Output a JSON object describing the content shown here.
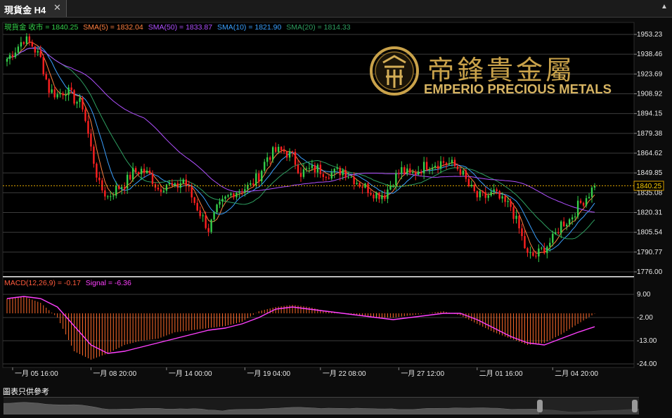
{
  "tab": {
    "title": "現貨金 H4",
    "close": "✕"
  },
  "window": {
    "menu_glyph": "▲"
  },
  "legend": [
    {
      "text": "現貨金 收市 = 1840.25",
      "color": "#35d04a"
    },
    {
      "text": "SMA(5) = 1832.04",
      "color": "#ff8040"
    },
    {
      "text": "SMA(50) = 1833.87",
      "color": "#b050ff"
    },
    {
      "text": "SMA(10) = 1821.90",
      "color": "#3aa0ff"
    },
    {
      "text": "SMA(20) = 1814.33",
      "color": "#2e9e60"
    }
  ],
  "macd_legend": [
    {
      "text": "MACD(12,26,9) = -0.17",
      "color": "#ff5a3c"
    },
    {
      "text": "Signal = -6.36",
      "color": "#ff40ff"
    }
  ],
  "logo": {
    "chinese": "帝鋒貴金屬",
    "english": "EMPERIO PRECIOUS METALS"
  },
  "current_price_label": "1840.25",
  "disclaimer": "圖表只供參考",
  "colors": {
    "up": "#35d04a",
    "down": "#ff2020",
    "gold": "#c9a24a",
    "price_line": "#d9a000"
  },
  "chart_data": {
    "type": "candlestick",
    "price_axis": {
      "ticks": [
        "1953.23",
        "1938.46",
        "1923.69",
        "1908.92",
        "1894.15",
        "1879.38",
        "1864.62",
        "1849.85",
        "1835.08",
        "1820.31",
        "1805.54",
        "1790.77",
        "1776.00"
      ],
      "range": [
        1776.0,
        1953.23
      ]
    },
    "macd_axis": {
      "ticks": [
        "9.00",
        "-2.00",
        "-13.00",
        "-24.00"
      ],
      "range": [
        -24,
        9
      ]
    },
    "time_labels": [
      "一月 05 16:00",
      "一月 08 20:00",
      "一月 14 00:00",
      "一月 19 04:00",
      "一月 22 08:00",
      "一月 27 12:00",
      "二月 01 16:00",
      "二月 04 20:00"
    ],
    "last_close": 1840.25,
    "close_anchors": [
      [
        0,
        1935
      ],
      [
        3,
        1942
      ],
      [
        6,
        1950
      ],
      [
        9,
        1945
      ],
      [
        12,
        1935
      ],
      [
        15,
        1912
      ],
      [
        18,
        1908
      ],
      [
        21,
        1912
      ],
      [
        24,
        1905
      ],
      [
        27,
        1900
      ],
      [
        30,
        1868
      ],
      [
        33,
        1840
      ],
      [
        36,
        1832
      ],
      [
        39,
        1838
      ],
      [
        42,
        1842
      ],
      [
        45,
        1850
      ],
      [
        48,
        1852
      ],
      [
        51,
        1848
      ],
      [
        54,
        1838
      ],
      [
        57,
        1842
      ],
      [
        60,
        1838
      ],
      [
        63,
        1845
      ],
      [
        66,
        1832
      ],
      [
        69,
        1820
      ],
      [
        72,
        1808
      ],
      [
        75,
        1822
      ],
      [
        78,
        1830
      ],
      [
        81,
        1836
      ],
      [
        84,
        1838
      ],
      [
        87,
        1840
      ],
      [
        90,
        1848
      ],
      [
        93,
        1862
      ],
      [
        96,
        1866
      ],
      [
        99,
        1866
      ],
      [
        102,
        1862
      ],
      [
        105,
        1850
      ],
      [
        108,
        1852
      ],
      [
        111,
        1853
      ],
      [
        114,
        1850
      ],
      [
        117,
        1850
      ],
      [
        120,
        1852
      ],
      [
        123,
        1847
      ],
      [
        126,
        1842
      ],
      [
        129,
        1838
      ],
      [
        132,
        1834
      ],
      [
        135,
        1834
      ],
      [
        138,
        1845
      ],
      [
        141,
        1852
      ],
      [
        144,
        1848
      ],
      [
        147,
        1852
      ],
      [
        150,
        1856
      ],
      [
        153,
        1857
      ],
      [
        156,
        1858
      ],
      [
        159,
        1856
      ],
      [
        162,
        1852
      ],
      [
        165,
        1840
      ],
      [
        168,
        1832
      ],
      [
        171,
        1832
      ],
      [
        174,
        1835
      ],
      [
        177,
        1828
      ],
      [
        180,
        1825
      ],
      [
        183,
        1808
      ],
      [
        186,
        1788
      ],
      [
        189,
        1788
      ],
      [
        192,
        1794
      ],
      [
        195,
        1800
      ],
      [
        198,
        1812
      ],
      [
        201,
        1815
      ],
      [
        204,
        1825
      ],
      [
        207,
        1832
      ],
      [
        210,
        1840.25
      ]
    ],
    "macd_anchors": [
      [
        0,
        7
      ],
      [
        6,
        8
      ],
      [
        12,
        5
      ],
      [
        18,
        -2
      ],
      [
        24,
        -18
      ],
      [
        30,
        -22
      ],
      [
        36,
        -19
      ],
      [
        42,
        -15
      ],
      [
        48,
        -13
      ],
      [
        54,
        -12
      ],
      [
        60,
        -9
      ],
      [
        66,
        -8
      ],
      [
        72,
        -7
      ],
      [
        78,
        -6
      ],
      [
        84,
        -4
      ],
      [
        90,
        1
      ],
      [
        96,
        3
      ],
      [
        102,
        4
      ],
      [
        108,
        3
      ],
      [
        114,
        1
      ],
      [
        120,
        0
      ],
      [
        126,
        -1
      ],
      [
        132,
        -2
      ],
      [
        138,
        -2
      ],
      [
        144,
        -1
      ],
      [
        150,
        0
      ],
      [
        156,
        1
      ],
      [
        162,
        -1
      ],
      [
        168,
        -5
      ],
      [
        174,
        -9
      ],
      [
        180,
        -12
      ],
      [
        186,
        -15
      ],
      [
        192,
        -14
      ],
      [
        198,
        -10
      ],
      [
        204,
        -5
      ],
      [
        210,
        -0.17
      ]
    ],
    "signal_anchors": [
      [
        0,
        7
      ],
      [
        6,
        8
      ],
      [
        12,
        7
      ],
      [
        18,
        3
      ],
      [
        24,
        -6
      ],
      [
        30,
        -15
      ],
      [
        36,
        -19
      ],
      [
        42,
        -18
      ],
      [
        48,
        -16
      ],
      [
        54,
        -14
      ],
      [
        60,
        -12
      ],
      [
        66,
        -10
      ],
      [
        72,
        -8
      ],
      [
        78,
        -7
      ],
      [
        84,
        -5
      ],
      [
        90,
        -2
      ],
      [
        96,
        2
      ],
      [
        102,
        3
      ],
      [
        108,
        2
      ],
      [
        114,
        1
      ],
      [
        120,
        0
      ],
      [
        126,
        -1
      ],
      [
        132,
        -2
      ],
      [
        138,
        -3
      ],
      [
        144,
        -2
      ],
      [
        150,
        -1
      ],
      [
        156,
        0
      ],
      [
        162,
        0
      ],
      [
        168,
        -3
      ],
      [
        174,
        -7
      ],
      [
        180,
        -11
      ],
      [
        186,
        -14
      ],
      [
        192,
        -15
      ],
      [
        198,
        -12
      ],
      [
        204,
        -9
      ],
      [
        210,
        -6.36
      ]
    ]
  }
}
